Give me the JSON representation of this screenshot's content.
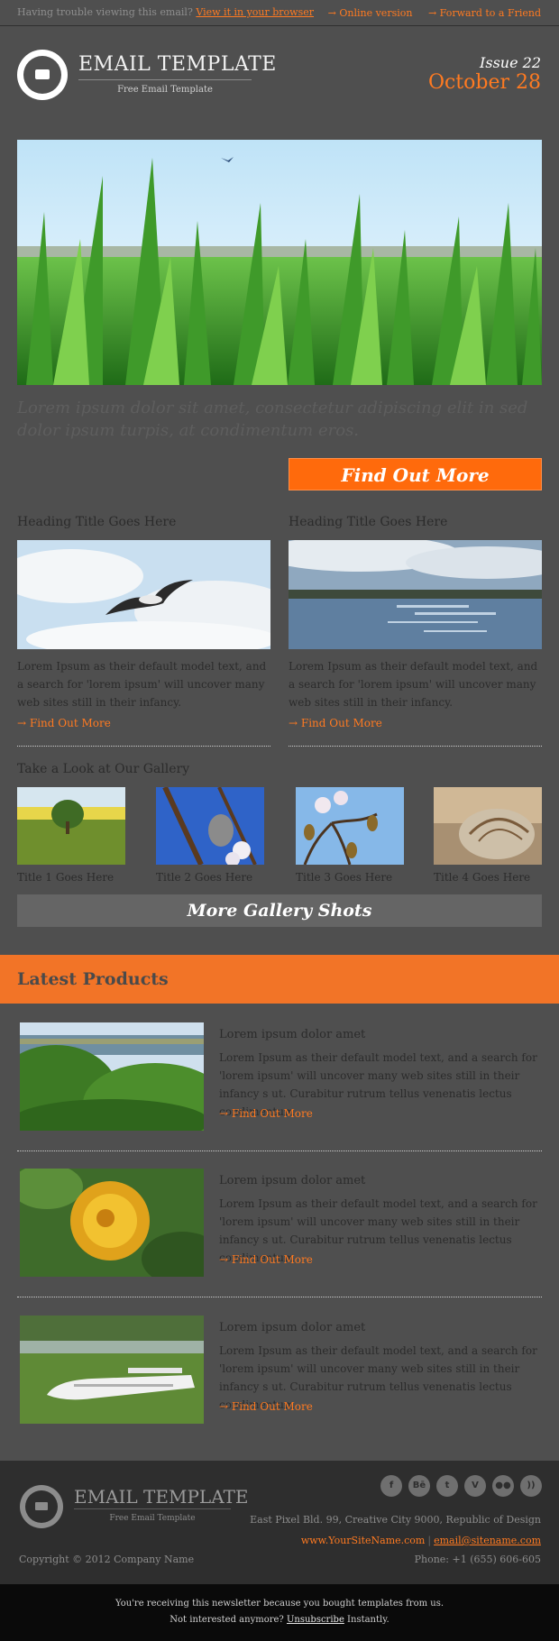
{
  "topbar": {
    "trouble_text": "Having trouble viewing this email?",
    "view_link": "View it in your browser",
    "online_version": "Online version",
    "forward": "Forward to a Friend",
    "arrow": "→"
  },
  "header": {
    "title": "EMAIL TEMPLATE",
    "subtitle": "Free Email Template",
    "issue": "Issue 22",
    "date": "October 28"
  },
  "hero": {
    "text": "Lorem ipsum dolor sit amet, consectetur adipiscing elit in sed dolor ipsum turpis, at condimentum eros.",
    "button": "Find Out More"
  },
  "columns": [
    {
      "heading": "Heading Title Goes Here",
      "text": "Lorem Ipsum as their default model text, and a search for 'lorem ipsum' will uncover many web sites still in their infancy.",
      "link": "Find Out More"
    },
    {
      "heading": "Heading Title Goes Here",
      "text": "Lorem Ipsum as their default model text, and a search for 'lorem ipsum' will uncover many web sites still in their infancy.",
      "link": "Find Out More"
    }
  ],
  "gallery": {
    "heading": "Take a Look at Our Gallery",
    "items": [
      "Title 1 Goes Here",
      "Title 2 Goes Here",
      "Title 3 Goes Here",
      "Title 4 Goes Here"
    ],
    "button": "More Gallery Shots"
  },
  "products": {
    "heading": "Latest Products",
    "items": [
      {
        "title": "Lorem ipsum dolor amet",
        "text": "Lorem Ipsum as their default model text, and a search for 'lorem ipsum' will uncover many web sites still in their infancy s ut. Curabitur rutrum tellus venenatis lectus condimentum.",
        "link": "Find Out More"
      },
      {
        "title": "Lorem ipsum dolor amet",
        "text": "Lorem Ipsum as their default model text, and a search for 'lorem ipsum' will uncover many web sites still in their infancy s ut. Curabitur rutrum tellus venenatis lectus condimentum.",
        "link": "Find Out More"
      },
      {
        "title": "Lorem ipsum dolor amet",
        "text": "Lorem Ipsum as their default model text, and a search for 'lorem ipsum' will uncover many web sites still in their infancy s ut. Curabitur rutrum tellus venenatis lectus condimentum.",
        "link": "Find Out More"
      }
    ]
  },
  "footer": {
    "title": "EMAIL TEMPLATE",
    "subtitle": "Free Email Template",
    "social": [
      {
        "icon": "facebook-icon",
        "glyph": "f"
      },
      {
        "icon": "behance-icon",
        "glyph": "Bē"
      },
      {
        "icon": "twitter-icon",
        "glyph": "t"
      },
      {
        "icon": "vimeo-icon",
        "glyph": "V"
      },
      {
        "icon": "flickr-icon",
        "glyph": "●●"
      },
      {
        "icon": "rss-icon",
        "glyph": "))"
      }
    ],
    "address": "East Pixel Bld. 99, Creative City 9000, Republic of Design",
    "website": "www.YourSiteName.com",
    "divider": "|",
    "email": "email@sitename.com",
    "copyright": "Copyright © 2012 Company Name",
    "phone": "Phone: +1 (655) 606-605",
    "note1": "You're receiving this newsletter because you bought templates from us.",
    "note2_pre": "Not interested anymore?",
    "unsubscribe": "Unsubscribe",
    "note2_post": "Instantly."
  },
  "colors": {
    "accent": "#ff7a21",
    "band": "#f27427",
    "background": "#4f4f4f"
  }
}
